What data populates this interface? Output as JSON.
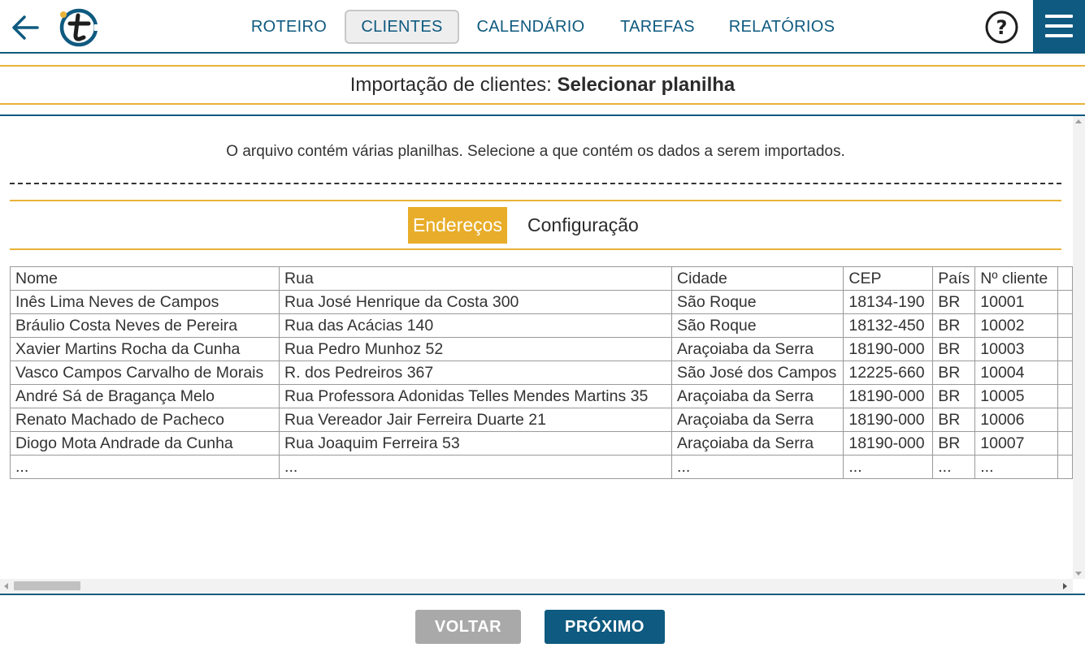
{
  "nav": {
    "items": [
      {
        "label": "ROTEIRO",
        "active": false
      },
      {
        "label": "CLIENTES",
        "active": true
      },
      {
        "label": "CALENDÁRIO",
        "active": false
      },
      {
        "label": "TAREFAS",
        "active": false
      },
      {
        "label": "RELATÓRIOS",
        "active": false
      }
    ],
    "help_label": "?",
    "colors": {
      "primary": "#0f5a80",
      "accent": "#e8b339"
    }
  },
  "title": {
    "prefix": "Importação de clientes: ",
    "strong": "Selecionar planilha"
  },
  "instruction": "O arquivo contém várias planilhas. Selecione a que contém os dados a serem importados.",
  "sheets": [
    {
      "label": "Endereços",
      "active": true
    },
    {
      "label": "Configuração",
      "active": false
    }
  ],
  "table": {
    "headers": [
      "Nome",
      "Rua",
      "Cidade",
      "CEP",
      "País",
      "Nº cliente"
    ],
    "rows": [
      [
        "Inês Lima Neves de Campos",
        "Rua José Henrique da Costa 300",
        "São Roque",
        "18134-190",
        "BR",
        "10001"
      ],
      [
        "Bráulio Costa Neves de Pereira",
        "Rua das Acácias 140",
        "São Roque",
        "18132-450",
        "BR",
        "10002"
      ],
      [
        "Xavier Martins Rocha da Cunha",
        "Rua Pedro Munhoz 52",
        "Araçoiaba da Serra",
        "18190-000",
        "BR",
        "10003"
      ],
      [
        "Vasco Campos Carvalho de Morais",
        "R. dos Pedreiros 367",
        "São José dos Campos",
        "12225-660",
        "BR",
        "10004"
      ],
      [
        "André Sá de Bragança Melo",
        "Rua Professora Adonidas Telles Mendes Martins 35",
        "Araçoiaba da Serra",
        "18190-000",
        "BR",
        "10005"
      ],
      [
        "Renato Machado de Pacheco",
        "Rua Vereador Jair Ferreira Duarte 21",
        "Araçoiaba da Serra",
        "18190-000",
        "BR",
        "10006"
      ],
      [
        "Diogo Mota Andrade da Cunha",
        "Rua Joaquim Ferreira 53",
        "Araçoiaba da Serra",
        "18190-000",
        "BR",
        "10007"
      ],
      [
        "...",
        "...",
        "...",
        "...",
        "...",
        "..."
      ]
    ]
  },
  "footer": {
    "back_label": "VOLTAR",
    "next_label": "PRÓXIMO"
  }
}
